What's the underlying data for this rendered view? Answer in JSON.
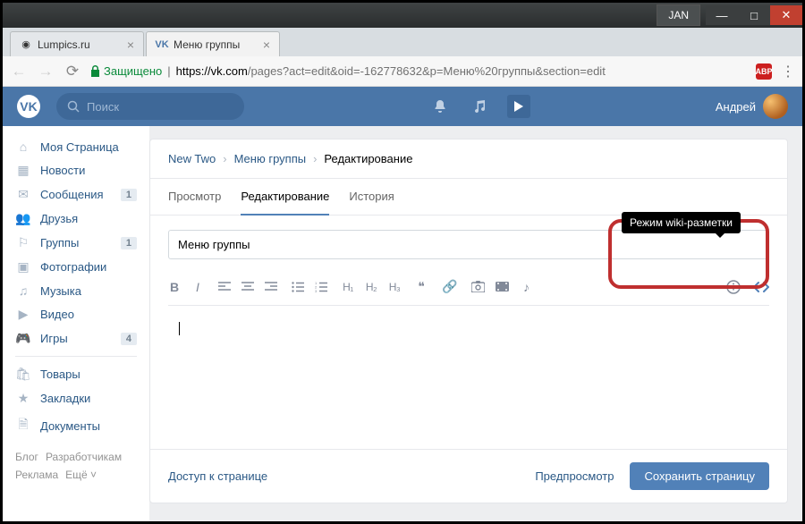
{
  "os_window": {
    "label": "JAN"
  },
  "browser": {
    "tabs": [
      {
        "title": "Lumpics.ru",
        "active": false
      },
      {
        "title": "Меню группы",
        "active": true
      }
    ],
    "address": {
      "secure_label": "Защищено",
      "host": "https://vk.com",
      "path": "/pages?act=edit&oid=-162778632&p=Меню%20группы&section=edit"
    },
    "extension_badge": "ABP"
  },
  "vk": {
    "search_placeholder": "Поиск",
    "username": "Андрей",
    "sidebar": {
      "items": [
        {
          "icon": "home",
          "label": "Моя Страница"
        },
        {
          "icon": "news",
          "label": "Новости"
        },
        {
          "icon": "messages",
          "label": "Сообщения",
          "badge": "1"
        },
        {
          "icon": "friends",
          "label": "Друзья"
        },
        {
          "icon": "groups",
          "label": "Группы",
          "badge": "1"
        },
        {
          "icon": "photos",
          "label": "Фотографии"
        },
        {
          "icon": "music",
          "label": "Музыка"
        },
        {
          "icon": "video",
          "label": "Видео"
        },
        {
          "icon": "games",
          "label": "Игры",
          "badge": "4"
        }
      ],
      "items2": [
        {
          "icon": "market",
          "label": "Товары"
        },
        {
          "icon": "bookmark",
          "label": "Закладки"
        },
        {
          "icon": "docs",
          "label": "Документы"
        }
      ],
      "footer": [
        "Блог",
        "Разработчикам",
        "Реклама",
        "Ещё ˅"
      ]
    },
    "breadcrumb": {
      "root": "New Two",
      "mid": "Меню группы",
      "current": "Редактирование"
    },
    "tabs": {
      "view": "Просмотр",
      "edit": "Редактирование",
      "history": "История"
    },
    "editor": {
      "title_value": "Меню группы",
      "tooltip": "Режим wiki-разметки",
      "headings": [
        "H₁",
        "H₂",
        "H₃"
      ]
    },
    "footer": {
      "access": "Доступ к странице",
      "preview": "Предпросмотр",
      "save": "Сохранить страницу"
    }
  }
}
